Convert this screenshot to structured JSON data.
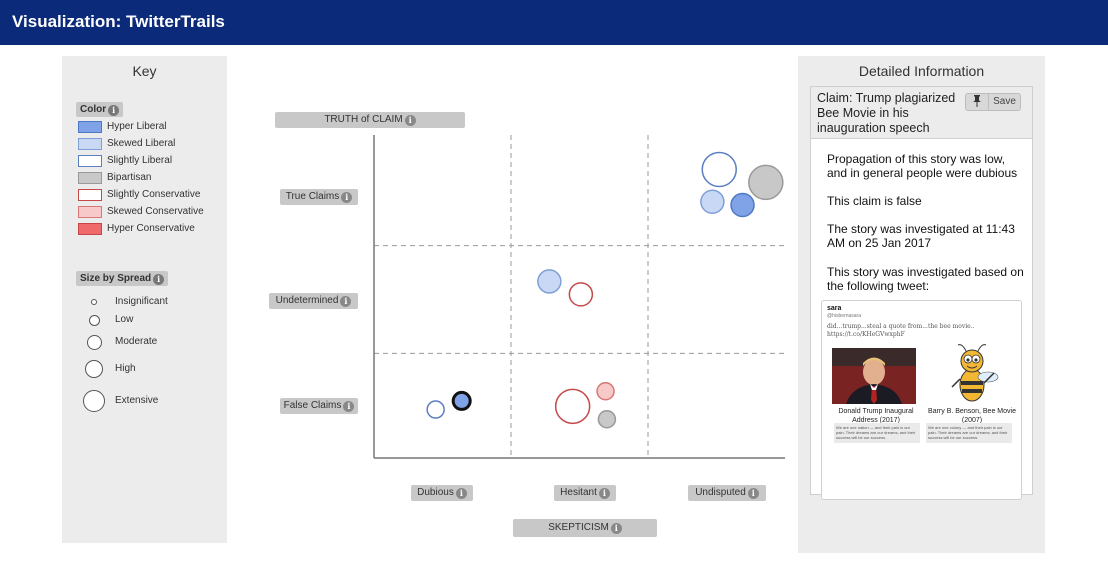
{
  "app": {
    "title": "Visualization: TwitterTrails"
  },
  "key": {
    "title": "Key",
    "color_label": "Color",
    "colors": [
      {
        "label": "Hyper Liberal",
        "fill": "#7fa3e6",
        "stroke": "#4f79c7"
      },
      {
        "label": "Skewed Liberal",
        "fill": "#c9d8f5",
        "stroke": "#7f9fd6"
      },
      {
        "label": "Slightly Liberal",
        "fill": "#ffffff",
        "stroke": "#5b7fc2"
      },
      {
        "label": "Bipartisan",
        "fill": "#c8c8c8",
        "stroke": "#999999"
      },
      {
        "label": "Slightly Conservative",
        "fill": "#ffffff",
        "stroke": "#c44a4a"
      },
      {
        "label": "Skewed Conservative",
        "fill": "#f7c9c9",
        "stroke": "#d77777"
      },
      {
        "label": "Hyper Conservative",
        "fill": "#ef6a6a",
        "stroke": "#c94444"
      }
    ],
    "size_label": "Size by Spread",
    "sizes": [
      {
        "label": "Insignificant",
        "size": 1
      },
      {
        "label": "Low",
        "size": 2
      },
      {
        "label": "Moderate",
        "size": 3
      },
      {
        "label": "High",
        "size": 4
      },
      {
        "label": "Extensive",
        "size": 5
      }
    ]
  },
  "chart": {
    "y_title": "TRUTH of CLAIM",
    "x_title": "SKEPTICISM",
    "y_categories": [
      "True Claims",
      "Undetermined",
      "False Claims"
    ],
    "x_categories": [
      "Dubious",
      "Hesitant",
      "Undisputed"
    ],
    "bubbles": [
      {
        "x": "Undisputed",
        "y": "True Claims",
        "color": "Slightly Liberal",
        "size": 4
      },
      {
        "x": "Undisputed",
        "y": "True Claims",
        "color": "Bipartisan",
        "size": 4
      },
      {
        "x": "Undisputed",
        "y": "True Claims",
        "color": "Skewed Liberal",
        "size": 2
      },
      {
        "x": "Undisputed",
        "y": "True Claims",
        "color": "Hyper Liberal",
        "size": 2
      },
      {
        "x": "Hesitant",
        "y": "Undetermined",
        "color": "Skewed Liberal",
        "size": 2
      },
      {
        "x": "Hesitant",
        "y": "Undetermined",
        "color": "Slightly Conservative",
        "size": 2
      },
      {
        "x": "Dubious",
        "y": "False Claims",
        "color": "Slightly Liberal",
        "size": 1
      },
      {
        "x": "Dubious",
        "y": "False Claims",
        "color": "Hyper Liberal",
        "size": 1,
        "selected": true
      },
      {
        "x": "Hesitant",
        "y": "False Claims",
        "color": "Slightly Conservative",
        "size": 4
      },
      {
        "x": "Hesitant",
        "y": "False Claims",
        "color": "Skewed Conservative",
        "size": 1
      },
      {
        "x": "Hesitant",
        "y": "False Claims",
        "color": "Bipartisan",
        "size": 1
      }
    ]
  },
  "detail": {
    "title": "Detailed Information",
    "claim": "Claim: Trump plagiarized Bee Movie in his inauguration speech",
    "save_label": "Save",
    "paragraphs": [
      "Propagation of this story was low, and in general people were dubious",
      "This claim is false",
      "The story was investigated at 11:43 AM on 25 Jan 2017",
      "This story was investigated based on the following tweet:"
    ],
    "tweet": {
      "name": "sara",
      "handle": "@hisbernasara",
      "text": "did...trump...steal a quote from...the bee movie.. https://t.co/KHeGVwxphF",
      "caption1": "Donald Trump Inaugural Address (2017)",
      "caption2": "Barry B. Benson, Bee Movie (2007)",
      "quote1": "We are one nation — and their pain is our pain. Their dreams are our dreams; and their success will be our success.",
      "quote2": "We are one colony — and their pain is our pain. Their dreams are our dreams; and their success will be our success."
    }
  }
}
